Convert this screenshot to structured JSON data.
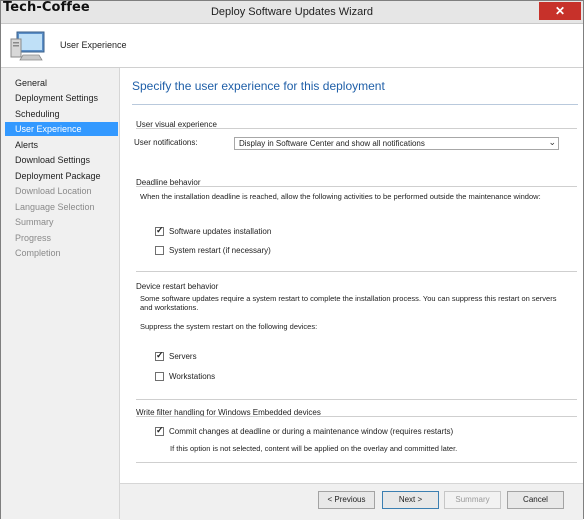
{
  "window": {
    "watermark": "Tech-Coffee",
    "title": "Deploy Software Updates Wizard",
    "close_glyph": "✕"
  },
  "header": {
    "icon": "computer-monitor-icon",
    "label": "User Experience"
  },
  "nav": {
    "items": [
      {
        "label": "General",
        "state": "normal"
      },
      {
        "label": "Deployment Settings",
        "state": "normal"
      },
      {
        "label": "Scheduling",
        "state": "normal"
      },
      {
        "label": "User Experience",
        "state": "selected"
      },
      {
        "label": "Alerts",
        "state": "normal"
      },
      {
        "label": "Download Settings",
        "state": "normal"
      },
      {
        "label": "Deployment Package",
        "state": "normal"
      },
      {
        "label": "Download Location",
        "state": "disabled"
      },
      {
        "label": "Language Selection",
        "state": "disabled"
      },
      {
        "label": "Summary",
        "state": "disabled"
      },
      {
        "label": "Progress",
        "state": "disabled"
      },
      {
        "label": "Completion",
        "state": "disabled"
      }
    ]
  },
  "main": {
    "heading": "Specify the user experience for this deployment",
    "visual": {
      "group_label": "User visual experience",
      "notifications_label": "User notifications:",
      "notifications_value": "Display in Software Center and show all notifications"
    },
    "deadline": {
      "group_label": "Deadline behavior",
      "description": "When the installation deadline is reached, allow the following activities to be performed outside the maintenance window:",
      "software_updates_label": "Software updates installation",
      "software_updates_checked": true,
      "system_restart_label": "System restart (if necessary)",
      "system_restart_checked": false
    },
    "restart": {
      "group_label": "Device restart behavior",
      "description_line1": "Some software updates require a system restart to complete the installation process. You can suppress this restart on servers",
      "description_line2": "and workstations.",
      "suppress_label": "Suppress the system restart on the following devices:",
      "servers_label": "Servers",
      "servers_checked": true,
      "workstations_label": "Workstations",
      "workstations_checked": false
    },
    "write_filter": {
      "group_label": "Write filter handling for Windows Embedded devices",
      "commit_label": "Commit changes at deadline or during a maintenance window (requires restarts)",
      "commit_checked": true,
      "note": "If this option is not selected, content will be applied on the overlay and committed later."
    }
  },
  "footer": {
    "previous_label": "< Previous",
    "next_label": "Next >",
    "summary_label": "Summary",
    "cancel_label": "Cancel"
  },
  "glyphs": {
    "check": "✓",
    "dropdown": "⌄"
  }
}
